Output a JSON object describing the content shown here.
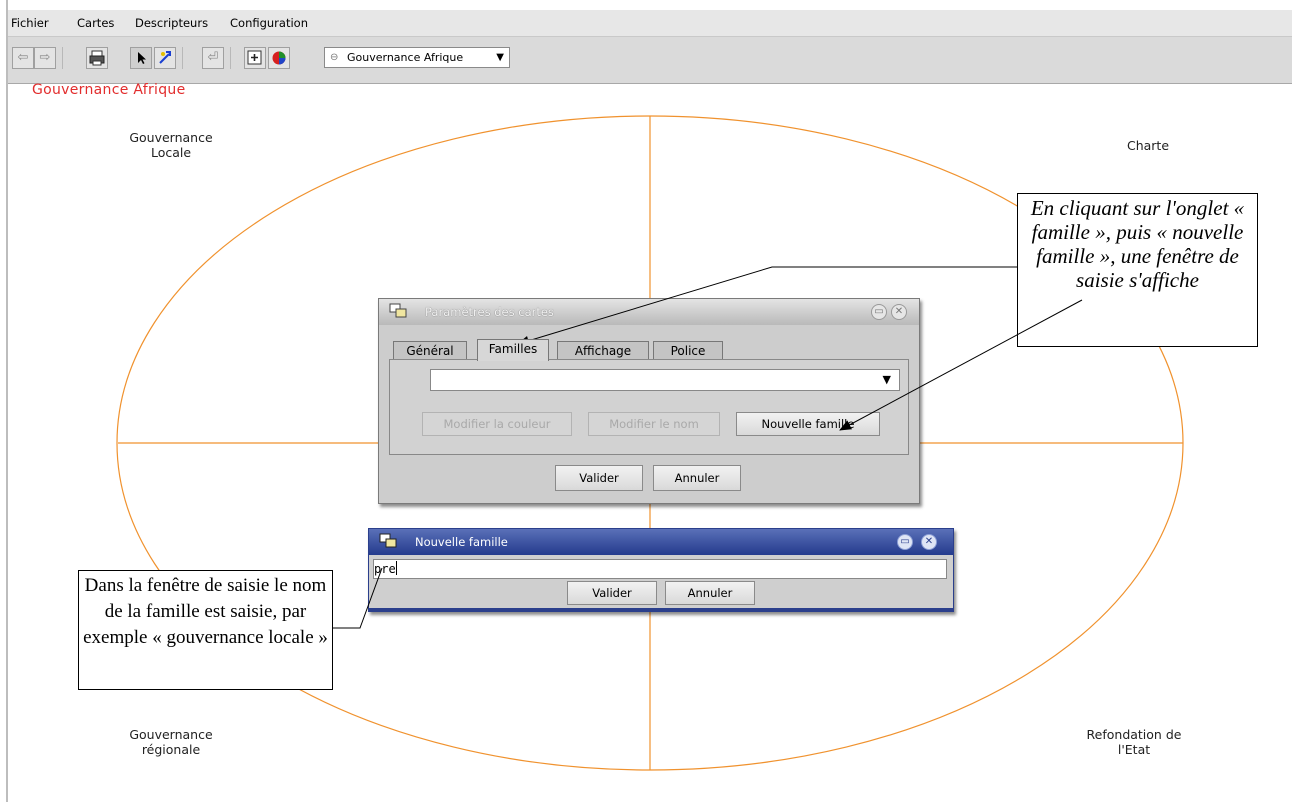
{
  "menu": [
    "Fichier",
    "Cartes",
    "Descripteurs",
    "Configuration"
  ],
  "toolbar": {
    "icons": [
      "back-arrow-icon",
      "forward-arrow-icon",
      "print-icon",
      "select-pointer-icon",
      "connect-tool-icon",
      "return-icon",
      "add-node-icon",
      "color-wheel-icon"
    ],
    "map_selector": {
      "value": "Gouvernance Afrique",
      "icon": "map-icon"
    }
  },
  "map": {
    "title": "Gouvernance Afrique",
    "quadrants": {
      "top_left": "Gouvernance\nLocale",
      "top_right": "Charte",
      "bottom_left": "Gouvernance\nrégionale",
      "bottom_right": "Refondation de\nl'Etat"
    },
    "line_color": "#f0922e"
  },
  "params_dialog": {
    "title": "Paramètres des cartes",
    "tabs": [
      "Général",
      "Familles",
      "Affichage",
      "Police"
    ],
    "active_tab": "Familles",
    "family_select_value": "",
    "buttons": {
      "modify_color": "Modifier la couleur",
      "modify_name": "Modifier le nom",
      "new_family": "Nouvelle famille"
    },
    "validate": "Valider",
    "cancel": "Annuler"
  },
  "new_family_dialog": {
    "title": "Nouvelle famille",
    "input_value": "pre",
    "validate": "Valider",
    "cancel": "Annuler"
  },
  "callouts": {
    "right": "En cliquant sur l'onglet « famille », puis « nouvelle famille », une fenêtre de saisie s'affiche",
    "left": "Dans la fenêtre de saisie le nom de la famille est saisie, par exemple « gouvernance locale »"
  }
}
